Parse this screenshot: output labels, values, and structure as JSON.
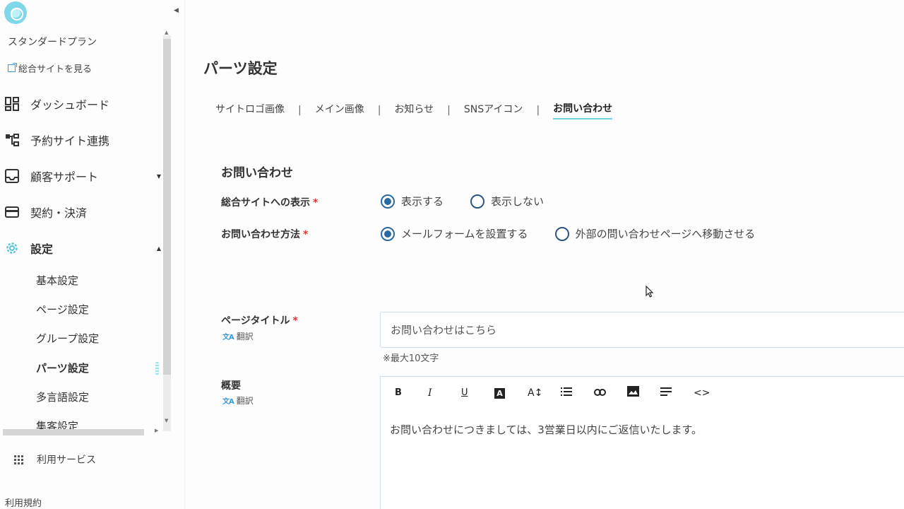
{
  "sidebar": {
    "plan": "スタンダードプラン",
    "site_link": "総合サイトを見る",
    "nav": [
      {
        "label": "ダッシュボード"
      },
      {
        "label": "予約サイト連携"
      },
      {
        "label": "顧客サポート"
      },
      {
        "label": "契約・決済"
      },
      {
        "label": "設定"
      }
    ],
    "sub": [
      {
        "label": "基本設定"
      },
      {
        "label": "ページ設定"
      },
      {
        "label": "グループ設定"
      },
      {
        "label": "パーツ設定"
      },
      {
        "label": "多言語設定"
      },
      {
        "label": "集客設定"
      }
    ],
    "services": "利用サービス",
    "terms": "利用規約"
  },
  "main": {
    "title": "パーツ設定",
    "tabs": [
      "サイトロゴ画像",
      "メイン画像",
      "お知らせ",
      "SNSアイコン",
      "お問い合わせ"
    ],
    "tab_sep": "|",
    "section": "お問い合わせ",
    "display_label": "総合サイトへの表示",
    "display_options": [
      "表示する",
      "表示しない"
    ],
    "method_label": "お問い合わせ方法",
    "method_options": [
      "メールフォームを設置する",
      "外部の問い合わせページへ移動させる"
    ],
    "required_mark": "*",
    "page_title_label": "ページタイトル",
    "translate": "翻訳",
    "page_title_value": "お問い合わせはこちら",
    "page_title_hint": "※最大10文字",
    "summary_label": "概要",
    "summary_value": "お問い合わせにつきましては、3営業日以内にご返信いたします。",
    "toolbar": {
      "bold": "B",
      "italic": "I",
      "underline": "U",
      "color": "A",
      "font_size": "A↕",
      "link": "🔗",
      "code": "<>"
    }
  }
}
